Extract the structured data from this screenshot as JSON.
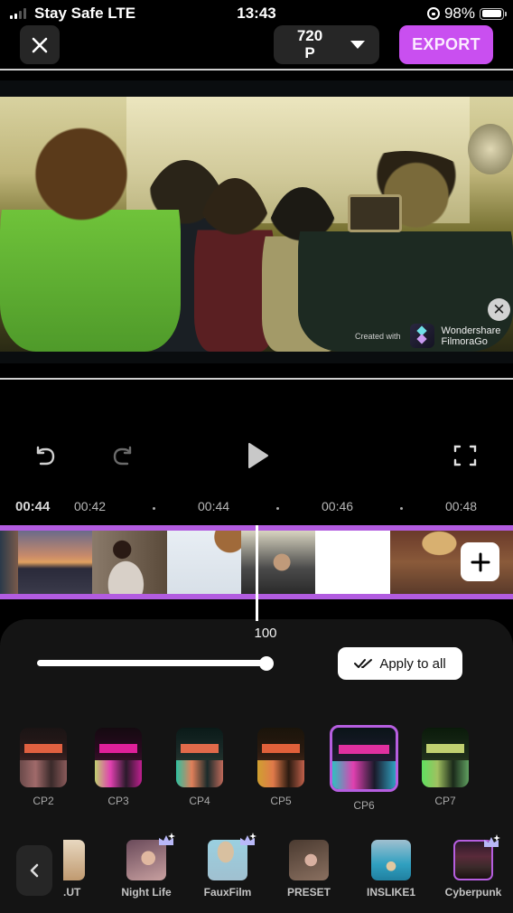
{
  "status_bar": {
    "carrier": "Stay Safe  LTE",
    "time": "13:43",
    "battery_percent": "98%",
    "battery_level": 0.98
  },
  "toolbar": {
    "close_icon": "close-icon",
    "resolution_line1": "720",
    "resolution_line2": "P",
    "resolution_dropdown_icon": "caret-down-icon",
    "export_label": "EXPORT",
    "export_color": "#c94ff0"
  },
  "preview": {
    "watermark_created": "Created with",
    "watermark_brand_line1": "Wondershare",
    "watermark_brand_line2": "FilmoraGo",
    "watermark_close_icon": "close-circle-icon"
  },
  "controls": {
    "undo_icon": "undo-icon",
    "redo_icon": "redo-icon",
    "play_icon": "play-icon",
    "fullscreen_icon": "fullscreen-icon"
  },
  "timeline": {
    "current_time": "00:44",
    "ticks": [
      "00:42",
      "00:44",
      "00:46",
      "00:48"
    ],
    "add_clip_icon": "plus-icon",
    "accent_color": "#b25ce0"
  },
  "adjust": {
    "intensity_value": "100",
    "intensity_fraction": 1.0,
    "apply_all_label": "Apply to all",
    "apply_all_icon": "double-check-icon"
  },
  "filters": {
    "items": [
      {
        "label": "CP2",
        "selected": false
      },
      {
        "label": "CP3",
        "selected": false
      },
      {
        "label": "CP4",
        "selected": false
      },
      {
        "label": "CP5",
        "selected": false
      },
      {
        "label": "CP6",
        "selected": true
      },
      {
        "label": "CP7",
        "selected": false
      }
    ]
  },
  "presets": {
    "back_icon": "chevron-left-icon",
    "items": [
      {
        "label": ".UT",
        "premium": false,
        "selected": false
      },
      {
        "label": "Night Life",
        "premium": true,
        "selected": false
      },
      {
        "label": "FauxFilm",
        "premium": true,
        "selected": false
      },
      {
        "label": "PRESET",
        "premium": false,
        "selected": false
      },
      {
        "label": "INSLIKE1",
        "premium": false,
        "selected": false
      },
      {
        "label": "Cyberpunk",
        "premium": true,
        "selected": true
      }
    ]
  }
}
